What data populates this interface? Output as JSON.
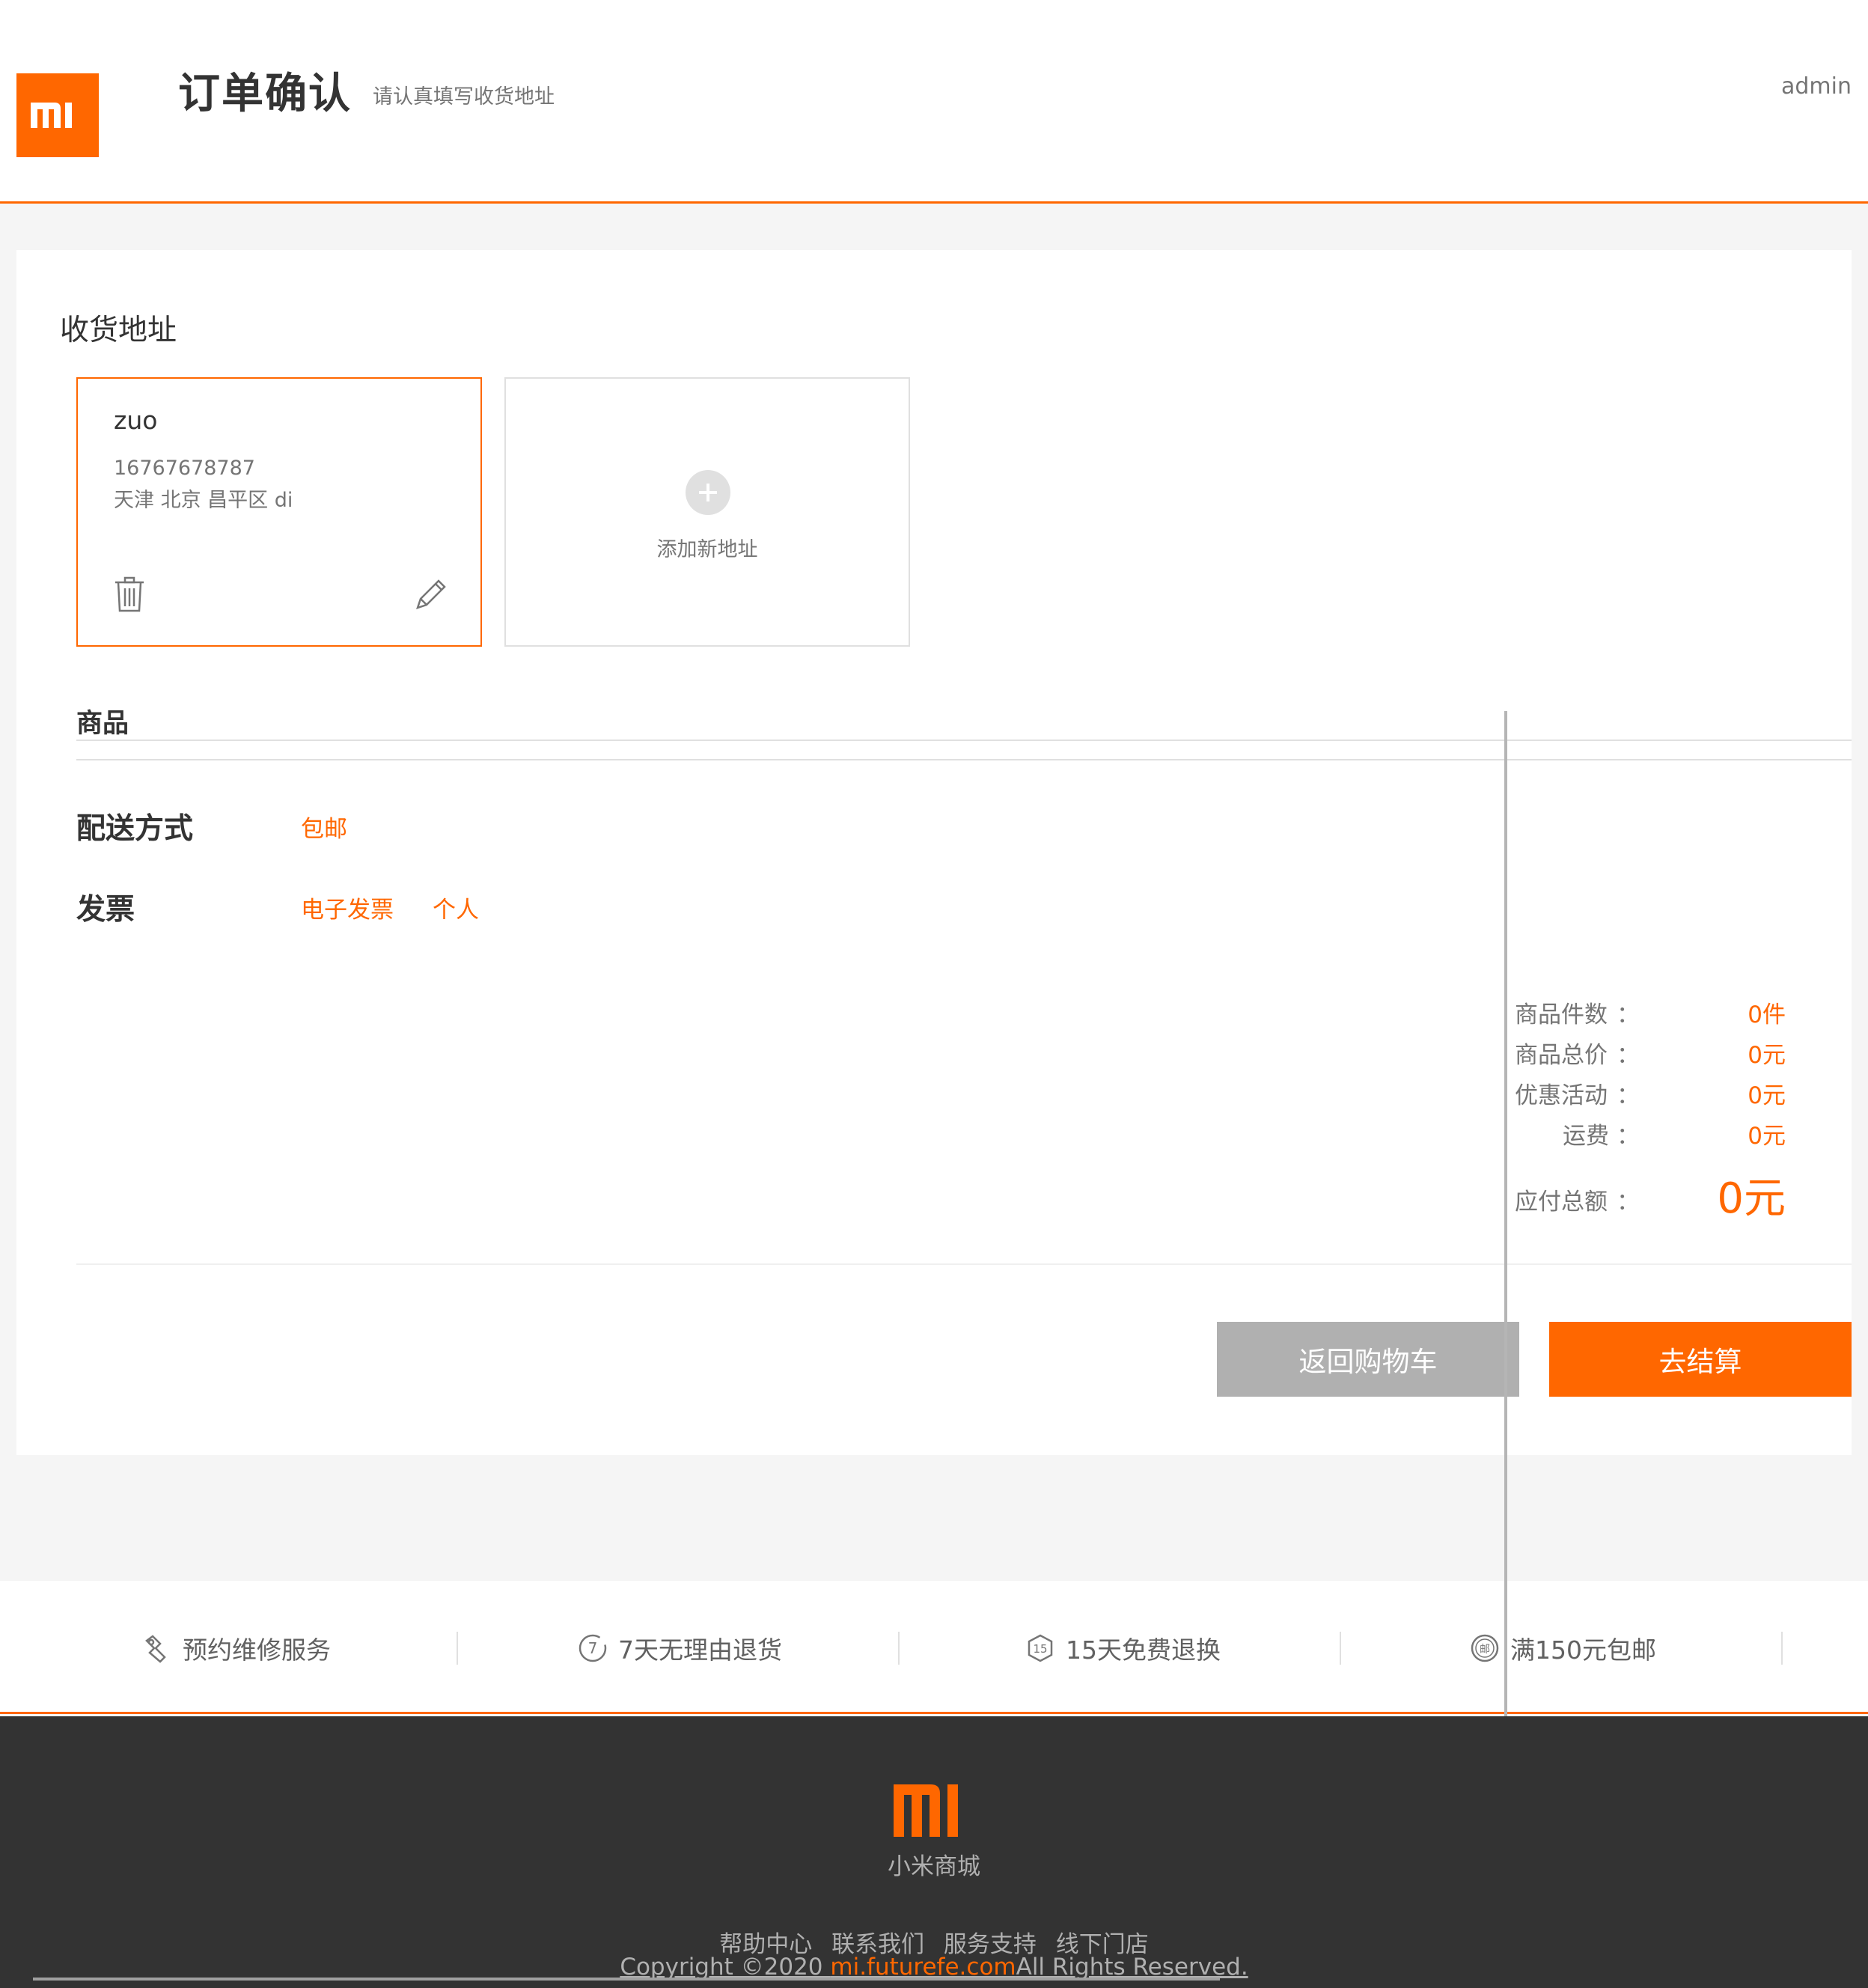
{
  "header": {
    "title": "订单确认",
    "subtitle": "请认真填写收货地址",
    "username": "admin",
    "logo_icon": "mi-logo-icon"
  },
  "address_section": {
    "title": "收货地址",
    "addresses": [
      {
        "name": "zuo",
        "phone": "16767678787",
        "detail": "天津 北京 昌平区 di"
      }
    ],
    "add_label": "添加新地址"
  },
  "goods": {
    "title": "商品"
  },
  "delivery": {
    "label": "配送方式",
    "value": "包邮"
  },
  "invoice": {
    "label": "发票",
    "type": "电子发票",
    "holder": "个人"
  },
  "summary": {
    "count_label": "商品件数",
    "count_value": "0件",
    "price_label": "商品总价",
    "price_value": "0元",
    "discount_label": "优惠活动",
    "discount_value": "0元",
    "shipping_label": "运费",
    "shipping_value": "0元",
    "total_label": "应付总额",
    "total_value": "0元",
    "colon": "："
  },
  "actions": {
    "back_label": "返回购物车",
    "checkout_label": "去结算"
  },
  "services": [
    {
      "label": "预约维修服务",
      "icon": "wrench-icon"
    },
    {
      "label": "7天无理由退货",
      "icon": "seven-days-icon"
    },
    {
      "label": "15天免费退换",
      "icon": "fifteen-days-icon"
    },
    {
      "label": "满150元包邮",
      "icon": "free-shipping-icon"
    }
  ],
  "footer": {
    "brand": "小米商城",
    "links": [
      "帮助中心",
      "联系我们",
      "服务支持",
      "线下门店"
    ],
    "copyright_prefix": "Copyright ©2020 ",
    "copyright_link": "mi.futurefe.com",
    "copyright_suffix": "All Rights Reserved."
  },
  "colors": {
    "accent": "#ff6700",
    "footer_bg": "#333333",
    "page_bg": "#f5f5f5"
  }
}
